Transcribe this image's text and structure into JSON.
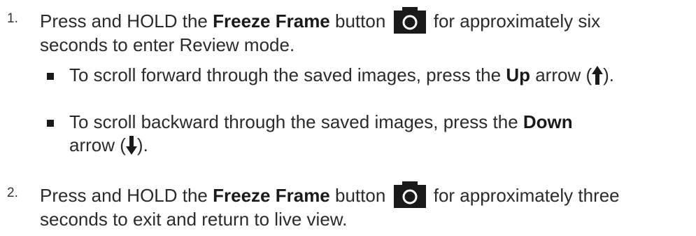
{
  "steps": [
    {
      "number": "1.",
      "line1_pre": "Press and HOLD the ",
      "button_name": "Freeze Frame",
      "line1_mid": " button ",
      "line1_post": " for approximately six",
      "line2": "seconds to enter Review mode.",
      "icon": "camera-icon"
    },
    {
      "number": "2.",
      "line1_pre": "Press and HOLD the ",
      "button_name": "Freeze Frame",
      "line1_mid": " button ",
      "line1_post": " for approximately three",
      "line2": "seconds to exit and return to live view.",
      "icon": "camera-icon"
    }
  ],
  "bullets": [
    {
      "pre": "To scroll forward through the saved images, press the ",
      "key": "Up",
      "post": " arrow (",
      "close": ").",
      "icon": "up-arrow-icon"
    },
    {
      "pre": "To scroll backward through the saved images, press the ",
      "key": "Down",
      "line2_pre": "arrow (",
      "close": ").",
      "icon": "down-arrow-icon"
    }
  ],
  "colors": {
    "icon_fill": "#1a1a1a",
    "text": "#2b2b2b"
  }
}
